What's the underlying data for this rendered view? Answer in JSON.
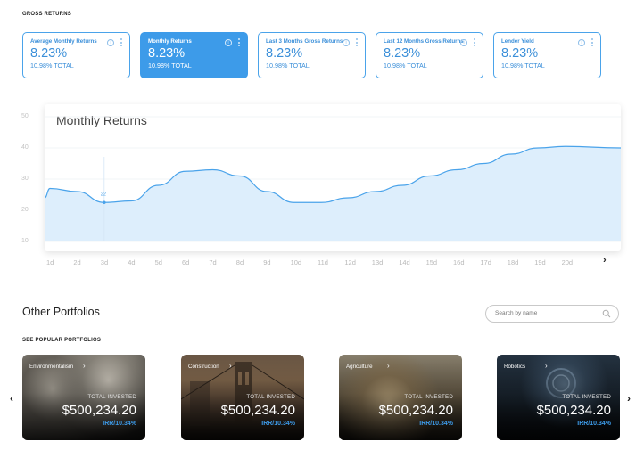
{
  "header": {
    "section_label": "GROSS RETURNS"
  },
  "stats": [
    {
      "title": "Average Monthly Returns",
      "value": "8.23%",
      "sub": "10.98% TOTAL",
      "active": false
    },
    {
      "title": "Monthly Returns",
      "value": "8.23%",
      "sub": "10.98% TOTAL",
      "active": true
    },
    {
      "title": "Last 3 Months Gross Returns",
      "value": "8.23%",
      "sub": "10.98% TOTAL",
      "active": false
    },
    {
      "title": "Last 12 Months Gross Returns",
      "value": "8.23%",
      "sub": "10.98% TOTAL",
      "active": false
    },
    {
      "title": "Lender Yield",
      "value": "8.23%",
      "sub": "10.98% TOTAL",
      "active": false
    }
  ],
  "stat_icons": {
    "info": "info-icon",
    "menu": "more-vert-icon"
  },
  "chart_data": {
    "type": "area",
    "title": "Monthly Returns",
    "x": [
      "1d",
      "2d",
      "3d",
      "4d",
      "5d",
      "6d",
      "7d",
      "8d",
      "9d",
      "10d",
      "11d",
      "12d",
      "13d",
      "14d",
      "15d",
      "16d",
      "17d",
      "18d",
      "19d",
      "20d"
    ],
    "y_ticks": [
      10,
      20,
      30,
      40,
      50
    ],
    "ylim": [
      5,
      50
    ],
    "series": [
      {
        "values": [
          27,
          26,
          22.5,
          23,
          28,
          32.5,
          33,
          31,
          26,
          22.5,
          22.5,
          24,
          26,
          28,
          31,
          33,
          35,
          38,
          40,
          40.5
        ]
      }
    ],
    "highlight": {
      "x": "3d",
      "label": "22"
    },
    "grid": true,
    "color": "#4aa3ea",
    "fill": "#ddeefc"
  },
  "chart_next_icon": "chevron-right-icon",
  "portfolios": {
    "heading": "Other Portfolios",
    "search_placeholder": "Search by name",
    "subheading": "SEE POPULAR PORTFOLIOS",
    "cards": [
      {
        "name": "Environmentalism",
        "ti_label": "TOTAL INVESTED",
        "amount": "$500,234.20",
        "irr": "IRR/10.34%"
      },
      {
        "name": "Construction",
        "ti_label": "TOTAL INVESTED",
        "amount": "$500,234.20",
        "irr": "IRR/10.34%"
      },
      {
        "name": "Agriculture",
        "ti_label": "TOTAL INVESTED",
        "amount": "$500,234.20",
        "irr": "IRR/10.34%"
      },
      {
        "name": "Robotics",
        "ti_label": "TOTAL INVESTED",
        "amount": "$500,234.20",
        "irr": "IRR/10.34%"
      }
    ]
  },
  "carousel": {
    "prev": "‹",
    "next": "›"
  }
}
